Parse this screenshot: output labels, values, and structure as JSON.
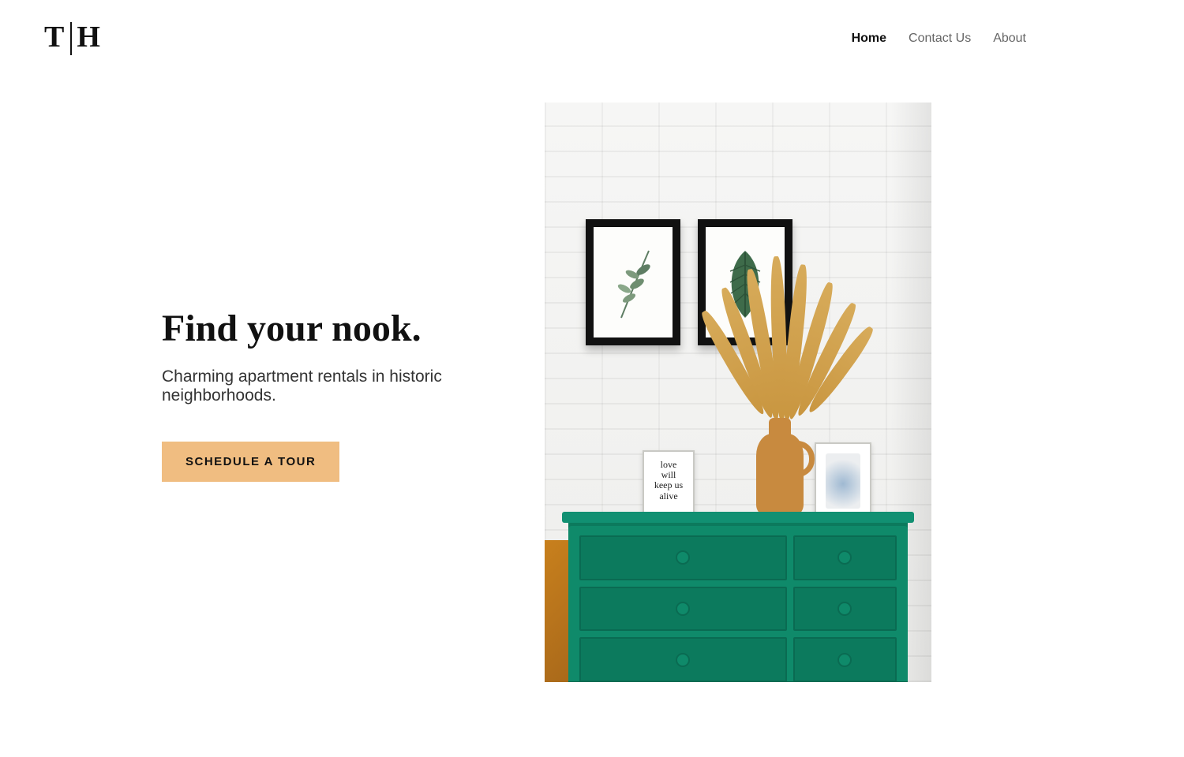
{
  "brand": {
    "left": "T",
    "right": "H"
  },
  "nav": {
    "items": [
      {
        "label": "Home",
        "active": true
      },
      {
        "label": "Contact Us",
        "active": false
      },
      {
        "label": "About",
        "active": false
      }
    ]
  },
  "hero": {
    "title": "Find your nook.",
    "subtitle": "Charming apartment rentals in historic neighborhoods.",
    "cta_label": "SCHEDULE A TOUR",
    "small_frame_text": "love will keep us alive"
  },
  "colors": {
    "accent_button": "#f0bd81",
    "dresser": "#0f8a6a",
    "vase": "#c88a3f"
  }
}
